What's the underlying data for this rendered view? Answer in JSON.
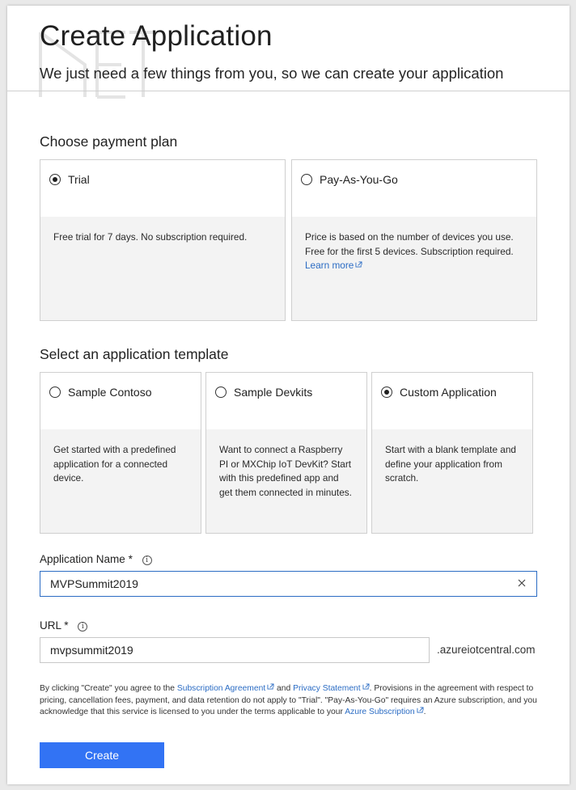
{
  "header": {
    "title": "Create Application",
    "subtitle": "We just need a few things from you, so we can create your application"
  },
  "payment_plan": {
    "section_label": "Choose payment plan",
    "options": [
      {
        "label": "Trial",
        "selected": true,
        "description": "Free trial for 7 days. No subscription required."
      },
      {
        "label": "Pay-As-You-Go",
        "selected": false,
        "description": "Price is based on the number of devices you use. Free for the first 5 devices. Subscription required.",
        "link_label": "Learn more"
      }
    ]
  },
  "template": {
    "section_label": "Select an application template",
    "options": [
      {
        "label": "Sample Contoso",
        "selected": false,
        "description": "Get started with a predefined application for a connected device."
      },
      {
        "label": "Sample Devkits",
        "selected": false,
        "description": "Want to connect a Raspberry PI or MXChip IoT DevKit? Start with this predefined app and get them connected in minutes."
      },
      {
        "label": "Custom Application",
        "selected": true,
        "description": "Start with a blank template and define your application from scratch."
      }
    ]
  },
  "app_name": {
    "label": "Application Name",
    "required_mark": "*",
    "value": "MVPSummit2019"
  },
  "url": {
    "label": "URL",
    "required_mark": "*",
    "value": "mvpsummit2019",
    "suffix": ".azureiotcentral.com"
  },
  "legal": {
    "part1": "By clicking \"Create\" you agree to the ",
    "subscription_agreement": "Subscription Agreement",
    "part2": " and ",
    "privacy_statement": "Privacy Statement",
    "part3": ". Provisions in the agreement with respect to pricing, cancellation fees, payment, and data retention do not apply to \"Trial\". \"Pay-As-You-Go\" requires an Azure subscription, and you acknowledge that this service is licensed to you under the terms applicable to your ",
    "azure_subscription": "Azure Subscription",
    "part4": "."
  },
  "create_button": "Create",
  "colors": {
    "accent": "#3273f4",
    "link": "#2b6cc4",
    "focus_border": "#2b6cc4"
  }
}
